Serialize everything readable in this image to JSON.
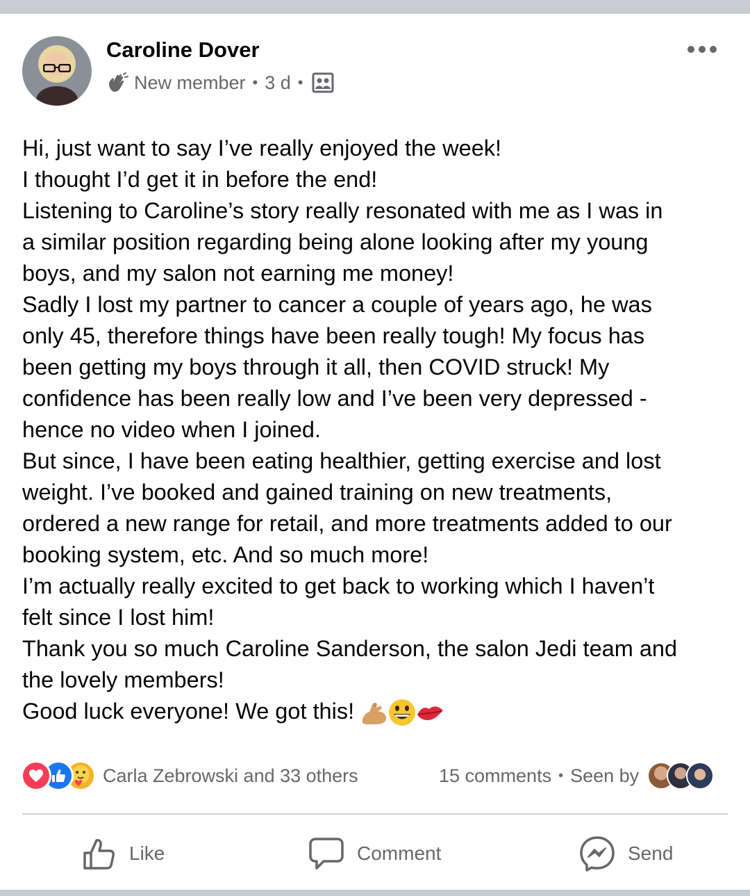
{
  "post": {
    "author": "Caroline Dover",
    "badge": "New member",
    "time": "3 d",
    "body_lines": [
      "Hi, just want to say I’ve really enjoyed the week!",
      "I thought I’d get it in before the end!",
      "Listening to Caroline’s story really resonated with me as I was in",
      "a similar position regarding being alone looking after my young",
      "boys, and my salon not earning me money!",
      "Sadly I lost my partner to cancer a couple of years ago, he was",
      "only 45, therefore things have been really tough! My focus has",
      "been getting my boys through it all, then COVID struck! My",
      "confidence has been really low and I’ve been very depressed -",
      "hence no video when I joined.",
      "But since, I have been eating healthier, getting exercise and lost",
      "weight. I’ve booked and gained training on new treatments,",
      "ordered a new range for retail, and more treatments added to our",
      "booking system, etc. And so much more!",
      "I’m actually really excited to get back to working which I haven’t",
      "felt since I lost him!",
      "Thank you so much Caroline Sanderson, the salon Jedi team and",
      "the lovely members!",
      "Good luck everyone! We got this!"
    ],
    "trailing_emojis": [
      "flexed-biceps-icon",
      "grinning-face-icon",
      "kiss-mark-icon"
    ]
  },
  "reactions": {
    "types": [
      "love",
      "like",
      "care"
    ],
    "summary": "Carla Zebrowski and 33 others"
  },
  "stats": {
    "comments": "15 comments",
    "seen_by": "Seen by"
  },
  "actions": {
    "like": "Like",
    "comment": "Comment",
    "send": "Send"
  },
  "colors": {
    "secondary_text": "#65676b",
    "love": "#f33e58",
    "like": "#1877f2",
    "care": "#f7b125",
    "separator": "#c9ccd1"
  }
}
